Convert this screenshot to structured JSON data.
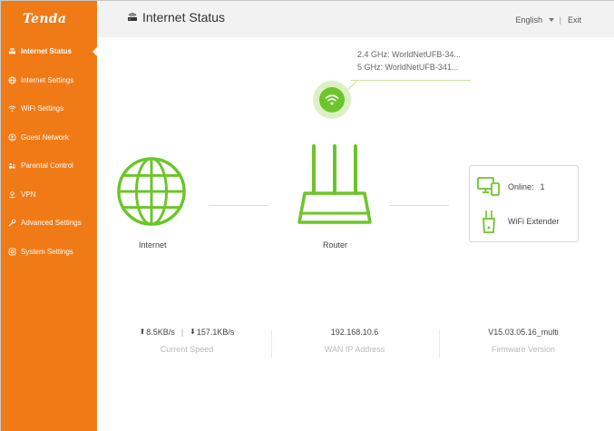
{
  "brand": {
    "logo": "Tenda"
  },
  "sidebar": {
    "items": [
      {
        "label": "Internet Status",
        "icon": "internet-status-icon",
        "active": true
      },
      {
        "label": "Internet Settings",
        "icon": "globe-icon",
        "active": false
      },
      {
        "label": "WiFi Settings",
        "icon": "wifi-icon",
        "active": false
      },
      {
        "label": "Guest Network",
        "icon": "guest-icon",
        "active": false
      },
      {
        "label": "Parental Control",
        "icon": "parental-icon",
        "active": false
      },
      {
        "label": "VPN",
        "icon": "vpn-icon",
        "active": false
      },
      {
        "label": "Advanced Settings",
        "icon": "wrench-icon",
        "active": false
      },
      {
        "label": "System Settings",
        "icon": "gear-icon",
        "active": false
      }
    ]
  },
  "header": {
    "title": "Internet Status",
    "language": "English",
    "separator": "|",
    "exit_label": "Exit"
  },
  "wifi": {
    "ssid_24": "2.4 GHz: WorldNetUFB-34...",
    "ssid_5": "5 GHz: WorldNetUFB-341..."
  },
  "diagram": {
    "internet_label": "Internet",
    "router_label": "Router",
    "online_label": "Online:",
    "online_count": "1",
    "extender_label": "WiFi Extender"
  },
  "stats": {
    "upload_speed": "8.5KB/s",
    "download_speed": "157.1KB/s",
    "speed_separator": "|",
    "current_speed_label": "Current Speed",
    "wan_ip": "192.168.10.6",
    "wan_ip_label": "WAN IP Address",
    "firmware": "V15.03.05.16_multi",
    "firmware_label": "Firmware Version"
  },
  "colors": {
    "sidebar": "#f07a16",
    "accent_green": "#6cc52a",
    "light_green": "#dcf0c4"
  }
}
